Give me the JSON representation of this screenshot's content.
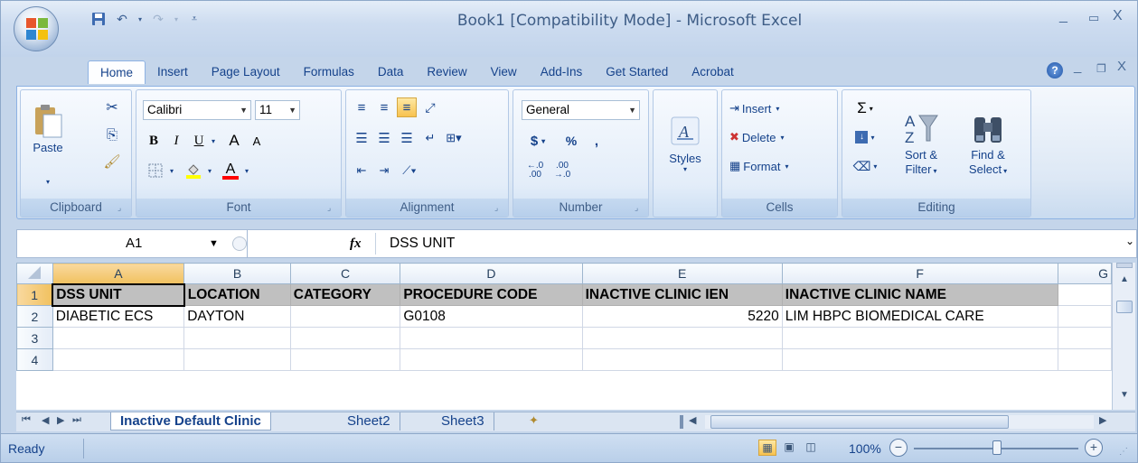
{
  "window": {
    "title": "Book1  [Compatibility Mode] - Microsoft Excel"
  },
  "ribbon": {
    "tabs": [
      "Home",
      "Insert",
      "Page Layout",
      "Formulas",
      "Data",
      "Review",
      "View",
      "Add-Ins",
      "Get Started",
      "Acrobat"
    ],
    "active_tab": "Home",
    "clipboard": {
      "paste": "Paste",
      "label": "Clipboard"
    },
    "font": {
      "name": "Calibri",
      "size": "11",
      "bold": "B",
      "italic": "I",
      "underline": "U",
      "grow": "A",
      "shrink": "A",
      "color_a": "A",
      "label": "Font"
    },
    "alignment": {
      "label": "Alignment"
    },
    "number": {
      "format": "General",
      "currency": "$",
      "percent": "%",
      "comma": ",",
      "inc_dec": "←.0 .00",
      "dec_dec": ".00 →.0",
      "label": "Number"
    },
    "styles": {
      "label": "Styles"
    },
    "cells": {
      "insert": "Insert",
      "delete": "Delete",
      "format": "Format",
      "label": "Cells"
    },
    "editing": {
      "sigma": "Σ",
      "sort": "Sort &",
      "filter": "Filter",
      "find": "Find &",
      "select": "Select",
      "label": "Editing"
    }
  },
  "formula_bar": {
    "name_box": "A1",
    "fx": "fx",
    "content": "DSS UNIT"
  },
  "sheet": {
    "columns": [
      "A",
      "B",
      "C",
      "D",
      "E",
      "F",
      "G"
    ],
    "rows": [
      {
        "num": "1",
        "cells": [
          "DSS UNIT",
          "LOCATION",
          "CATEGORY",
          "PROCEDURE CODE",
          "INACTIVE CLINIC IEN",
          "INACTIVE CLINIC NAME",
          ""
        ]
      },
      {
        "num": "2",
        "cells": [
          "DIABETIC ECS",
          "DAYTON",
          "",
          "G0108",
          "5220",
          "LIM HBPC BIOMEDICAL CARE",
          ""
        ]
      },
      {
        "num": "3",
        "cells": [
          "",
          "",
          "",
          "",
          "",
          "",
          ""
        ]
      },
      {
        "num": "4",
        "cells": [
          "",
          "",
          "",
          "",
          "",
          "",
          ""
        ]
      }
    ]
  },
  "sheet_tabs": {
    "tabs": [
      "Inactive Default Clinic",
      "Sheet2",
      "Sheet3"
    ],
    "active": "Inactive Default Clinic"
  },
  "status": {
    "ready": "Ready",
    "zoom": "100%"
  }
}
